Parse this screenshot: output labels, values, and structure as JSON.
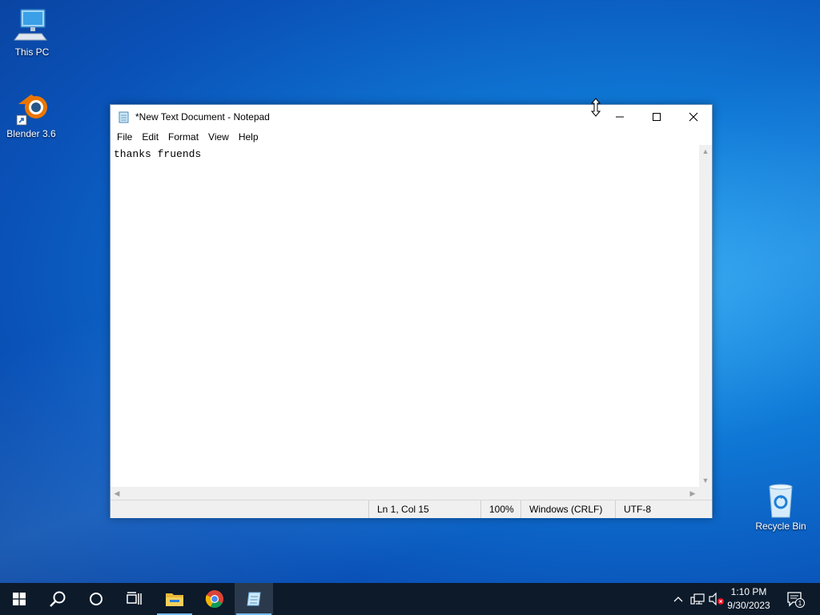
{
  "desktop": {
    "icons": [
      {
        "label": "This PC"
      },
      {
        "label": "Blender 3.6"
      },
      {
        "label": "Recycle Bin"
      }
    ]
  },
  "notepad": {
    "title": "*New Text Document - Notepad",
    "menu": [
      "File",
      "Edit",
      "Format",
      "View",
      "Help"
    ],
    "content": "thanks fruends",
    "status": {
      "position": "Ln 1, Col 15",
      "zoom": "100%",
      "line_ending": "Windows (CRLF)",
      "encoding": "UTF-8"
    }
  },
  "taskbar": {
    "clock_time": "1:10 PM",
    "clock_date": "9/30/2023",
    "notification_count": "1"
  },
  "colors": {
    "taskbar": "#0c1a2a",
    "accent": "#76b9ed",
    "desktop": "#0f78d6"
  }
}
